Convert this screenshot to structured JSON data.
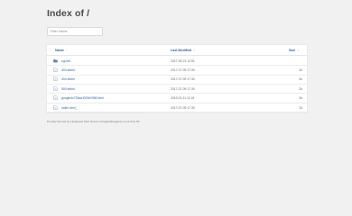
{
  "title": "Index of /",
  "filter": {
    "placeholder": "Filter Name",
    "value": ""
  },
  "table": {
    "headers": {
      "name": "Name",
      "name_arrow": "↑",
      "modified": "Last Modified",
      "modified_arrow": "↕",
      "size": "Size",
      "size_arrow": "↕"
    },
    "rows": [
      {
        "name": "cgi-bin",
        "type": "folder",
        "modified": "2017-09-21 12:51",
        "size": ""
      },
      {
        "name": "403.shtml",
        "type": "file",
        "modified": "2017-07-09 17:30",
        "size": "2k"
      },
      {
        "name": "404.shtml",
        "type": "file",
        "modified": "2017-07-09 17:30",
        "size": "2k"
      },
      {
        "name": "500.shtml",
        "type": "file",
        "modified": "2017-07-09 17:30",
        "size": "2k"
      },
      {
        "name": "google4c733aa1926e7f68.html",
        "type": "file",
        "modified": "2019-01-11 11:16",
        "size": "2k"
      },
      {
        "name": "index.html_",
        "type": "file",
        "modified": "2017-07-09 17:30",
        "size": "2k"
      }
    ]
  },
  "footer": "Proudly Served by LiteSpeed Web Server at bigandfeisgame.co.uk Port 80",
  "colors": {
    "link": "#2a5db0",
    "folder_icon": "#5b7fc0",
    "file_icon": "#8aa0c8"
  }
}
